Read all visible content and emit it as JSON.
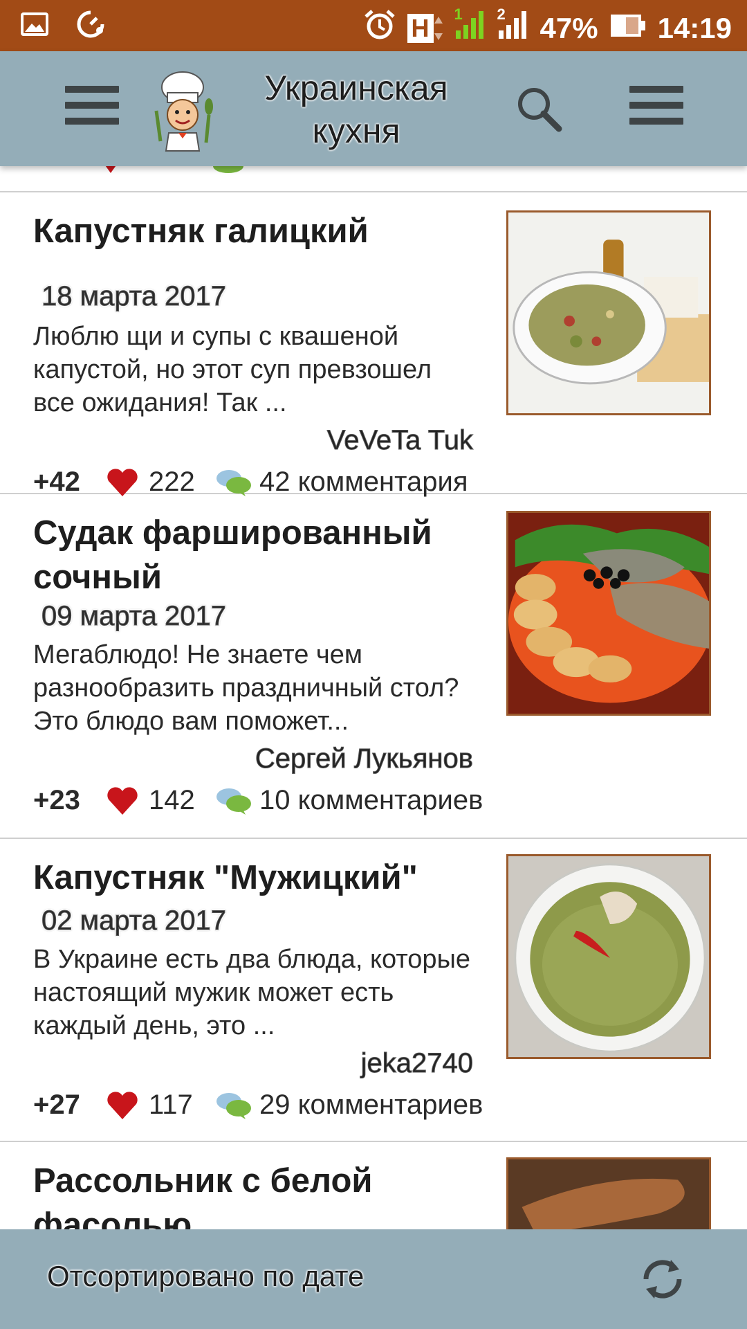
{
  "status_bar": {
    "network": "H",
    "sim1": "1",
    "sim2": "2",
    "battery": "47%",
    "time": "14:19",
    "icons": [
      "image-icon",
      "data-saver-icon",
      "alarm-icon",
      "signal-icon",
      "battery-icon"
    ]
  },
  "app_bar": {
    "title": "Украинская кухня",
    "icons": [
      "menu-icon",
      "chef-logo",
      "search-icon",
      "overflow-menu-icon"
    ]
  },
  "recipes": [
    {
      "title": "Капустняк галицкий",
      "date": "18 марта 2017",
      "description": "Люблю щи и супы с квашеной капустой, но этот суп превзошел все ожидания! Так ...",
      "author": "VeVeTa Tuk",
      "rating": "+42",
      "likes": "222",
      "comments": "42 комментария"
    },
    {
      "title": "Судак фаршированный сочный",
      "date": "09 марта 2017",
      "description": "Мегаблюдо! Не знаете чем разнообразить праздничный стол? Это блюдо вам поможет...",
      "author": "Сергей Лукьянов",
      "rating": "+23",
      "likes": "142",
      "comments": "10 комментариев"
    },
    {
      "title": "Капустняк \"Мужицкий\"",
      "date": "02 марта 2017",
      "description": "В Украине есть два блюда, которые настоящий мужик может есть каждый день, это ...",
      "author": "jeka2740",
      "rating": "+27",
      "likes": "117",
      "comments": "29 комментариев"
    },
    {
      "title": "Рассольник с белой фасолью"
    }
  ],
  "bottom_bar": {
    "sort_label": "Отсортировано по дате"
  },
  "colors": {
    "status_bar": "#a24b16",
    "app_bar": "#94adb8",
    "divider": "#cfcfcf",
    "thumb_border": "#9a5a2c",
    "heart": "#c8151b"
  }
}
